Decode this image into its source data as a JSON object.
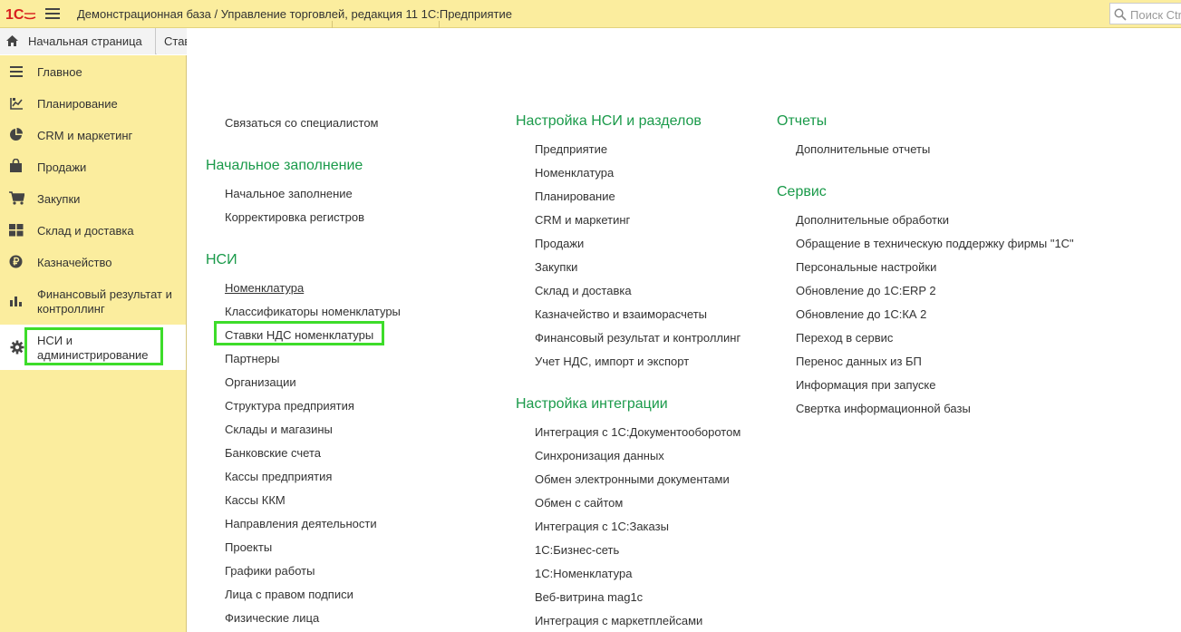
{
  "app": {
    "title": "Демонстрационная база / Управление торговлей, редакция 11 1С:Предприятие",
    "search_placeholder": "Поиск Ctrl+Shift+F",
    "logo_text": "1С"
  },
  "tabs": {
    "home_label": "Начальная страница",
    "other_label": "Ставки НДС номенклатуры"
  },
  "sidebar": {
    "items": [
      {
        "label": "Главное",
        "icon": "menu-lines-icon"
      },
      {
        "label": "Планирование",
        "icon": "planning-icon"
      },
      {
        "label": "CRM и маркетинг",
        "icon": "pie-chart-icon"
      },
      {
        "label": "Продажи",
        "icon": "shopping-bag-icon"
      },
      {
        "label": "Закупки",
        "icon": "cart-icon"
      },
      {
        "label": "Склад и доставка",
        "icon": "warehouse-grid-icon"
      },
      {
        "label": "Казначейство",
        "icon": "ruble-coin-icon"
      },
      {
        "label": "Финансовый результат и контроллинг",
        "icon": "bar-chart-icon"
      },
      {
        "label": "НСИ и администрирование",
        "icon": "gear-icon"
      }
    ]
  },
  "content": {
    "col1": {
      "top_link": "Связаться со специалистом",
      "sections": [
        {
          "title": "Начальное заполнение",
          "items": [
            "Начальное заполнение",
            "Корректировка регистров"
          ]
        },
        {
          "title": "НСИ",
          "items": [
            "Номенклатура",
            "Классификаторы номенклатуры",
            "Ставки НДС номенклатуры",
            "Партнеры",
            "Организации",
            "Структура предприятия",
            "Склады и магазины",
            "Банковские счета",
            "Кассы предприятия",
            "Кассы ККМ",
            "Направления деятельности",
            "Проекты",
            "Графики работы",
            "Лица с правом подписи",
            "Физические лица"
          ]
        }
      ]
    },
    "col2": {
      "sections": [
        {
          "title": "Настройка НСИ и разделов",
          "items": [
            "Предприятие",
            "Номенклатура",
            "Планирование",
            "CRM и маркетинг",
            "Продажи",
            "Закупки",
            "Склад и доставка",
            "Казначейство и взаиморасчеты",
            "Финансовый результат и контроллинг",
            "Учет НДС, импорт и экспорт"
          ]
        },
        {
          "title": "Настройка интеграции",
          "items": [
            "Интеграция с 1С:Документооборотом",
            "Синхронизация данных",
            "Обмен электронными документами",
            "Обмен с сайтом",
            "Интеграция с 1С:Заказы",
            "1С:Бизнес-сеть",
            "1С:Номенклатура",
            "Веб-витрина mag1c",
            "Интеграция с маркетплейсами"
          ]
        }
      ]
    },
    "col3": {
      "sections": [
        {
          "title": "Отчеты",
          "items": [
            "Дополнительные отчеты"
          ]
        },
        {
          "title": "Сервис",
          "items": [
            "Дополнительные обработки",
            "Обращение в техническую поддержку фирмы \"1С\"",
            "Персональные настройки",
            "Обновление до 1С:ERP 2",
            "Обновление до 1С:КА 2",
            "Переход в сервис",
            "Перенос данных из БП",
            "Информация при запуске",
            "Свертка информационной базы"
          ]
        }
      ]
    }
  },
  "colors": {
    "header_bg": "#fbed9e",
    "section_title": "#1a9a4a",
    "highlight": "#3ddc2a",
    "logo_red": "#d81e1e"
  }
}
